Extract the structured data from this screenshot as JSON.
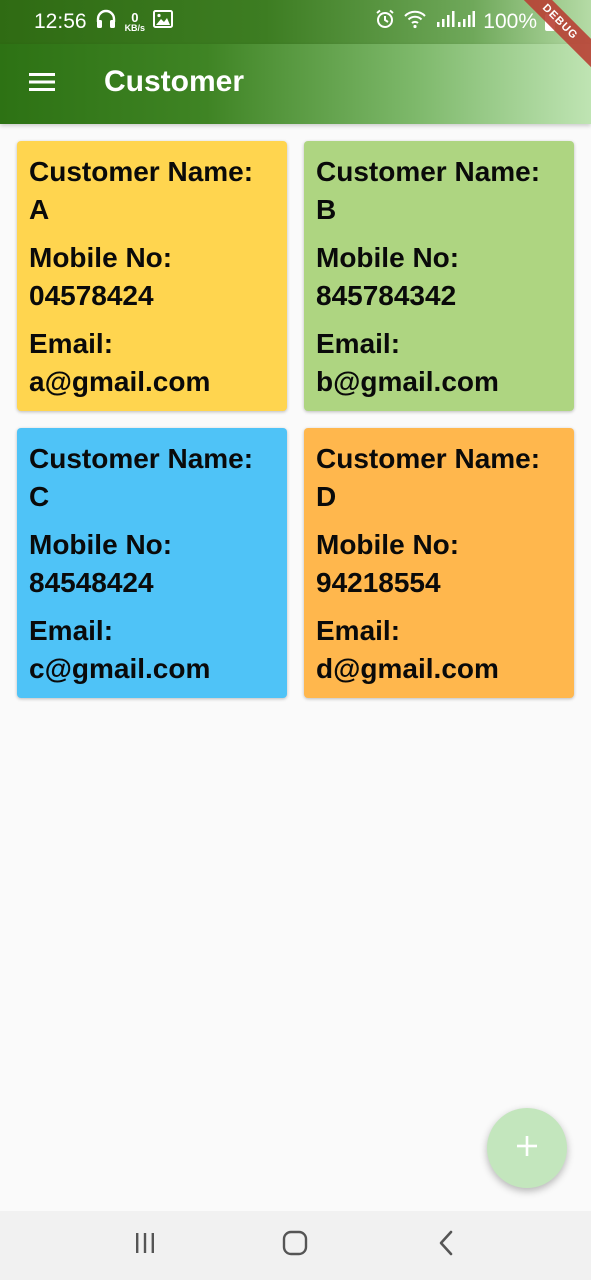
{
  "status_bar": {
    "time": "12:56",
    "net_speed_value": "0",
    "net_speed_unit": "KB/s",
    "battery": "100%",
    "icons": [
      "headphones-icon",
      "image-icon",
      "alarm-icon",
      "wifi-icon",
      "signal-icon",
      "battery-icon"
    ]
  },
  "app_bar": {
    "title": "Customer",
    "menu_icon": "hamburger-menu-icon",
    "background_color": "#3f8424"
  },
  "debug_banner": "DEBUG",
  "customers": [
    {
      "name_label": "Customer Name:",
      "name": "A",
      "mobile_label": "Mobile No:",
      "mobile": "04578424",
      "email_label": "Email:",
      "email": "a@gmail.com",
      "color": "#ffd54f"
    },
    {
      "name_label": "Customer Name:",
      "name": "B",
      "mobile_label": "Mobile No:",
      "mobile": "845784342",
      "email_label": "Email:",
      "email": "b@gmail.com",
      "color": "#aed581"
    },
    {
      "name_label": "Customer Name:",
      "name": "C",
      "mobile_label": "Mobile No:",
      "mobile": "84548424",
      "email_label": "Email:",
      "email": "c@gmail.com",
      "color": "#4fc3f7"
    },
    {
      "name_label": "Customer Name:",
      "name": "D",
      "mobile_label": "Mobile No:",
      "mobile": "94218554",
      "email_label": "Email:",
      "email": "d@gmail.com",
      "color": "#ffb74d"
    }
  ],
  "fab": {
    "icon": "plus-icon",
    "color": "#c3e6bd"
  },
  "nav_bar": {
    "icons": [
      "recent-apps-icon",
      "home-icon",
      "back-icon"
    ]
  }
}
